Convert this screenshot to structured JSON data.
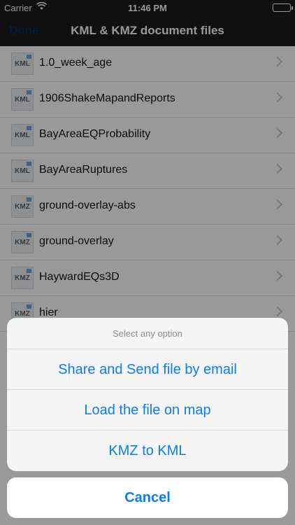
{
  "status": {
    "carrier": "Carrier",
    "time": "11:46 PM"
  },
  "nav": {
    "done_label": "Done",
    "title": "KML & KMZ document files"
  },
  "files": [
    {
      "name": "1.0_week_age",
      "type": "KML"
    },
    {
      "name": "1906ShakeMapandReports",
      "type": "KML"
    },
    {
      "name": "BayAreaEQProbability",
      "type": "KML"
    },
    {
      "name": "BayAreaRuptures",
      "type": "KML"
    },
    {
      "name": "ground-overlay-abs",
      "type": "KMZ"
    },
    {
      "name": "ground-overlay",
      "type": "KMZ"
    },
    {
      "name": "HaywardEQs3D",
      "type": "KMZ"
    },
    {
      "name": "hier",
      "type": "KMZ"
    }
  ],
  "action_sheet": {
    "title": "Select any option",
    "options": [
      "Share and Send file by email",
      "Load the file on map",
      "KMZ to KML"
    ],
    "cancel": "Cancel"
  },
  "colors": {
    "accent": "#0a7cf4",
    "navbar": "#1b1b1d"
  }
}
